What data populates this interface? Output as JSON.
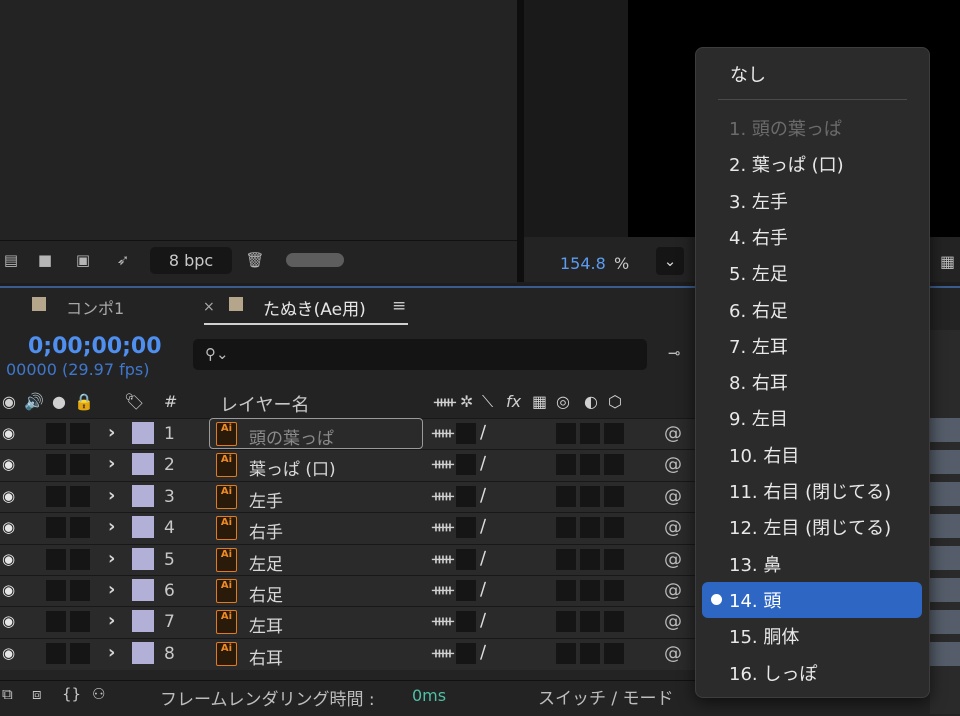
{
  "project_panel": {
    "bpc_label": "8 bpc",
    "icons": [
      "composition-icon",
      "folder-icon",
      "footage-icon",
      "render-icon",
      "trash-icon"
    ]
  },
  "viewer": {
    "zoom_value": "154.8",
    "zoom_unit": "%",
    "dropdown_chevron": "⌄"
  },
  "timeline": {
    "tabs": [
      {
        "label": "コンポ1",
        "close": ""
      },
      {
        "label": "たぬき(Ae用)",
        "close": "×",
        "menu": "≡"
      }
    ],
    "timecode": "0;00;00;00",
    "frames": "00000 (29.97 fps)",
    "search_placeholder": "",
    "column_header": {
      "layer_name": "レイヤー名",
      "number": "#"
    },
    "layers": [
      {
        "num": "1",
        "name": "頭の葉っぱ",
        "type": "Ai"
      },
      {
        "num": "2",
        "name": "葉っぱ (口)",
        "type": "Ai"
      },
      {
        "num": "3",
        "name": "左手",
        "type": "Ai"
      },
      {
        "num": "4",
        "name": "右手",
        "type": "Ai"
      },
      {
        "num": "5",
        "name": "左足",
        "type": "Ai"
      },
      {
        "num": "6",
        "name": "右足",
        "type": "Ai"
      },
      {
        "num": "7",
        "name": "左耳",
        "type": "Ai"
      },
      {
        "num": "8",
        "name": "右耳",
        "type": "Ai"
      }
    ],
    "status": {
      "render_label": "フレームレンダリング時間 :",
      "render_value": "0ms",
      "switch_mode": "スイッチ / モード"
    }
  },
  "parent_dropdown": {
    "none_label": "なし",
    "items": [
      {
        "label": "1. 頭の葉っぱ",
        "disabled": true
      },
      {
        "label": "2. 葉っぱ (口)"
      },
      {
        "label": "3. 左手"
      },
      {
        "label": "4. 右手"
      },
      {
        "label": "5. 左足"
      },
      {
        "label": "6. 右足"
      },
      {
        "label": "7. 左耳"
      },
      {
        "label": "8. 右耳"
      },
      {
        "label": "9. 左目"
      },
      {
        "label": "10. 右目"
      },
      {
        "label": "11. 右目 (閉じてる)"
      },
      {
        "label": "12. 左目 (閉じてる)"
      },
      {
        "label": "13. 鼻"
      },
      {
        "label": "14. 頭",
        "selected": true
      },
      {
        "label": "15. 胴体"
      },
      {
        "label": "16. しっぽ"
      }
    ]
  },
  "colors": {
    "accent_blue": "#4f8ff0",
    "highlight": "#2e66c4",
    "label_lavender": "#b3b0d8",
    "ai_orange": "#ee8a25",
    "render_green": "#4ec0a6"
  }
}
